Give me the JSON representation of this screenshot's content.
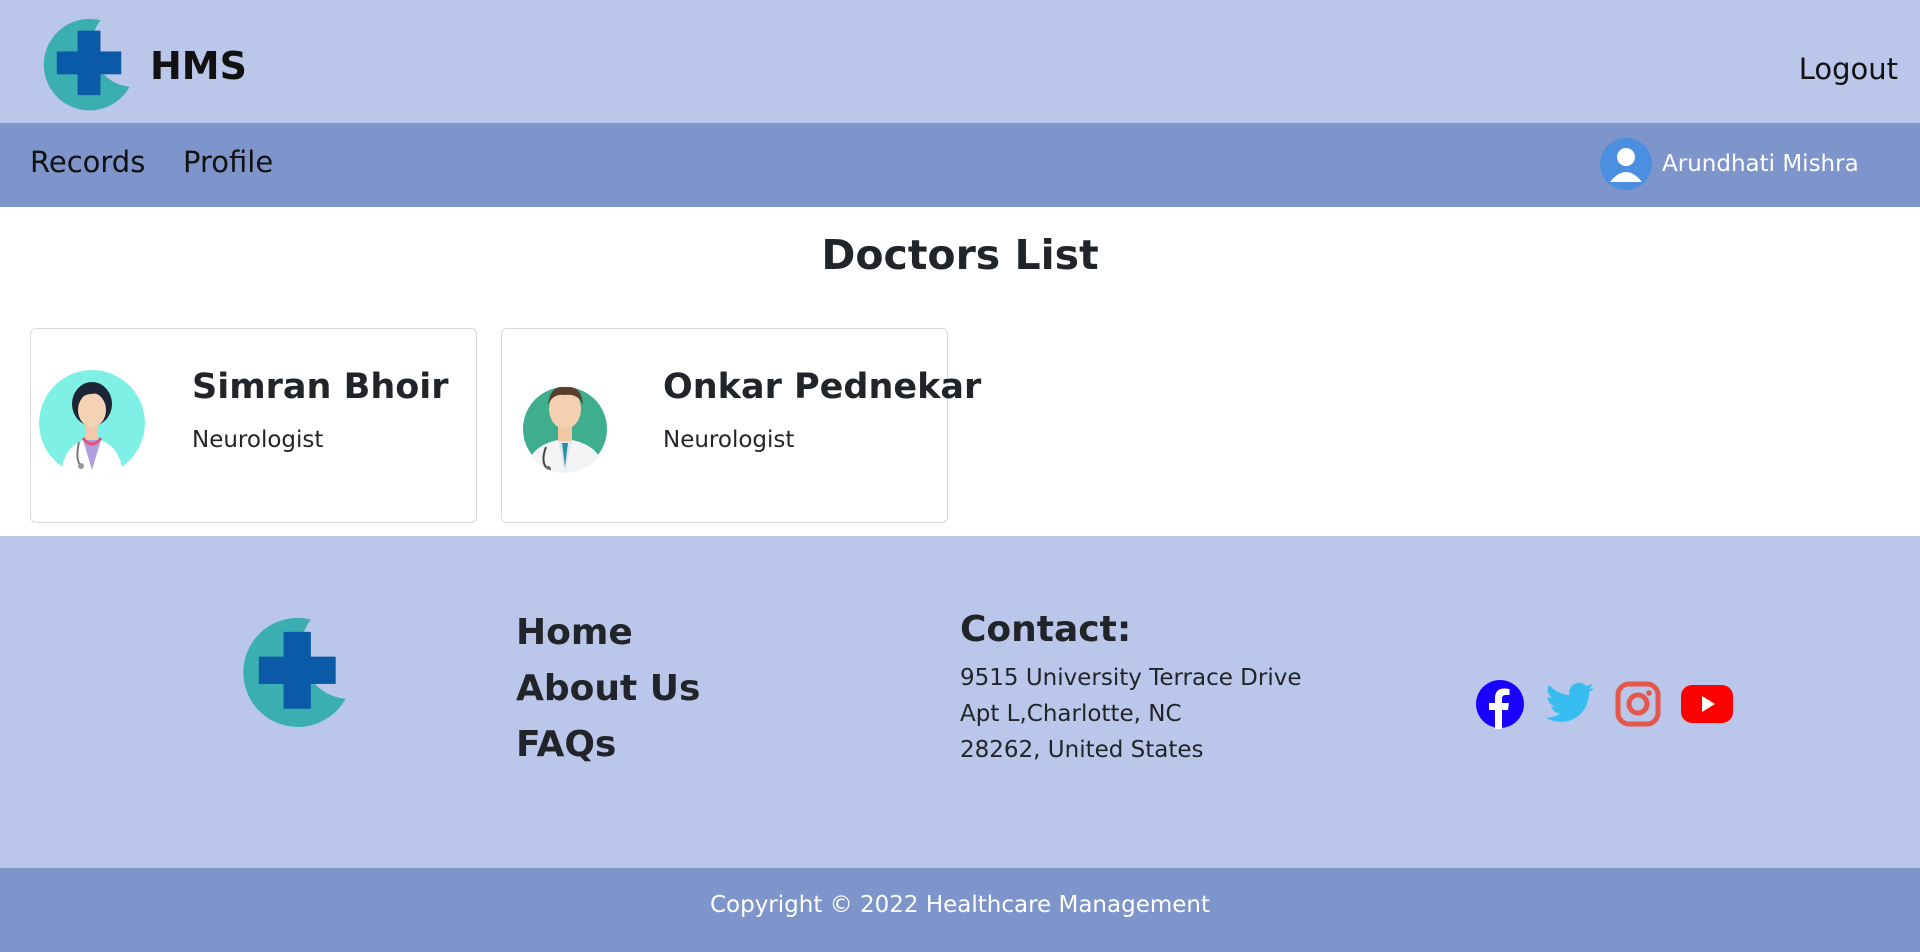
{
  "header": {
    "brand": "HMS",
    "logout_label": "Logout"
  },
  "nav": {
    "items": [
      {
        "label": "Records"
      },
      {
        "label": "Profile"
      }
    ],
    "user_name": "Arundhati Mishra"
  },
  "main": {
    "title": "Doctors List",
    "doctors": [
      {
        "name": "Simran Bhoir",
        "specialty": "Neurologist",
        "avatar": "female-doctor-avatar"
      },
      {
        "name": "Onkar Pednekar",
        "specialty": "Neurologist",
        "avatar": "male-doctor-avatar"
      }
    ]
  },
  "footer": {
    "links": [
      {
        "label": "Home"
      },
      {
        "label": "About Us"
      },
      {
        "label": "FAQs"
      }
    ],
    "contact_title": "Contact:",
    "address_lines": [
      "9515 University Terrace Drive",
      "Apt L,Charlotte, NC",
      "28262, United States"
    ],
    "socials": [
      {
        "name": "facebook-icon",
        "color": "#1a00ff"
      },
      {
        "name": "twitter-icon",
        "color": "#38bdf0"
      },
      {
        "name": "instagram-icon",
        "color": "#e4574a"
      },
      {
        "name": "youtube-icon",
        "color": "#ff0000"
      }
    ],
    "copyright": "Copyright  © 2022 Healthcare Management"
  },
  "colors": {
    "header_bg": "#bbc7ea",
    "nav_bg": "#7e95cb",
    "logo_teal": "#3aaeb0",
    "logo_blue": "#0b5aa8"
  }
}
